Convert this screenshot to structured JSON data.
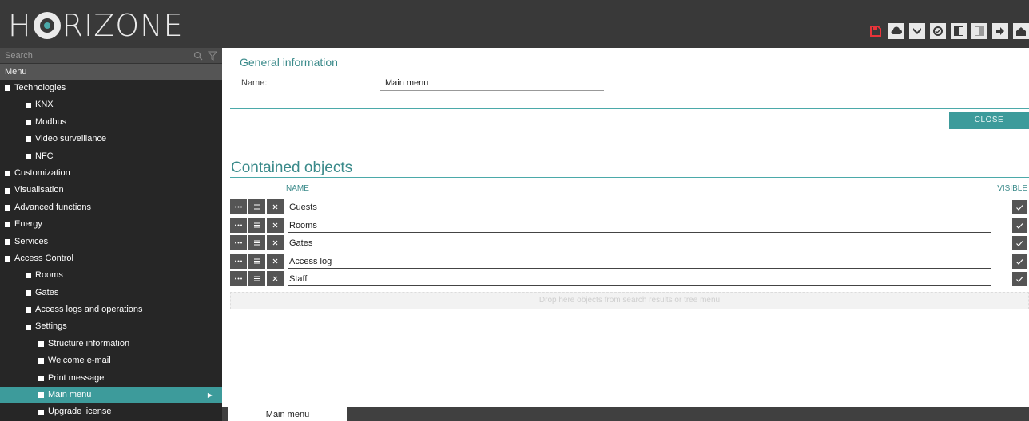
{
  "app": {
    "logo_text": "HORIZONE"
  },
  "header": {
    "toolbar": [
      {
        "icon": "save-icon"
      },
      {
        "icon": "cloud-icon"
      },
      {
        "icon": "tools-icon"
      },
      {
        "icon": "badge-icon"
      },
      {
        "icon": "panel-left-icon"
      },
      {
        "icon": "panel-right-icon"
      },
      {
        "icon": "logout-icon"
      },
      {
        "icon": "home-icon"
      }
    ]
  },
  "sidebar": {
    "search_placeholder": "Search",
    "menu_label": "Menu",
    "items": [
      {
        "label": "Technologies",
        "level": 0
      },
      {
        "label": "KNX",
        "level": 1
      },
      {
        "label": "Modbus",
        "level": 1
      },
      {
        "label": "Video surveillance",
        "level": 1
      },
      {
        "label": "NFC",
        "level": 1
      },
      {
        "label": "Customization",
        "level": 0
      },
      {
        "label": "Visualisation",
        "level": 0
      },
      {
        "label": "Advanced functions",
        "level": 0
      },
      {
        "label": "Energy",
        "level": 0
      },
      {
        "label": "Services",
        "level": 0
      },
      {
        "label": "Access Control",
        "level": 0
      },
      {
        "label": "Rooms",
        "level": 1
      },
      {
        "label": "Gates",
        "level": 1
      },
      {
        "label": "Access logs and operations",
        "level": 1
      },
      {
        "label": "Settings",
        "level": 1
      },
      {
        "label": "Structure information",
        "level": 2
      },
      {
        "label": "Welcome e-mail",
        "level": 2
      },
      {
        "label": "Print message",
        "level": 2
      },
      {
        "label": "Main menu",
        "level": 2,
        "active": true
      },
      {
        "label": "Upgrade license",
        "level": 2
      }
    ]
  },
  "general": {
    "title": "General information",
    "name_label": "Name:",
    "name_value": "Main menu",
    "close_label": "CLOSE"
  },
  "contained": {
    "title": "Contained objects",
    "col_name": "NAME",
    "col_visible": "VISIBLE",
    "rows": [
      {
        "name": "Guests",
        "visible": true
      },
      {
        "name": "Rooms",
        "visible": true
      },
      {
        "name": "Gates",
        "visible": true
      },
      {
        "name": "Access log",
        "visible": true
      },
      {
        "name": "Staff",
        "visible": true
      }
    ],
    "drop_text": "Drop here objects from search results or tree menu"
  },
  "tabs": [
    {
      "label": "Main menu"
    }
  ],
  "colors": {
    "accent": "#3d9b9b",
    "header_bg": "#393939",
    "sidebar_bg": "#262626"
  }
}
